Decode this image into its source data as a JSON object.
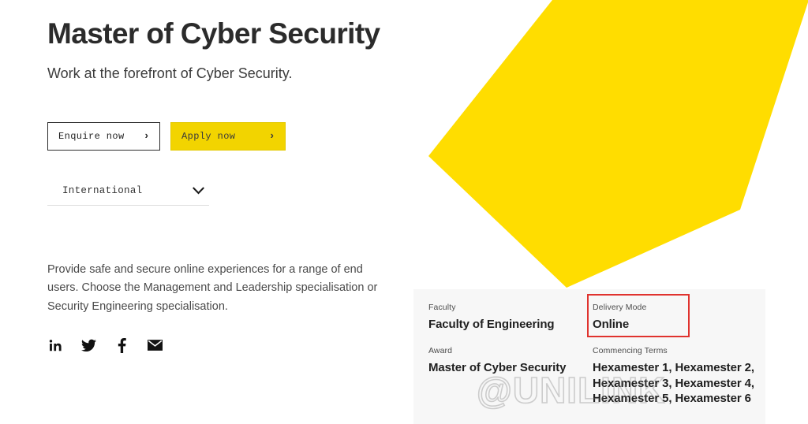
{
  "hero": {
    "title": "Master of Cyber Security",
    "subtitle": "Work at the forefront of Cyber Security.",
    "shape_color": "#FFDD00"
  },
  "actions": {
    "enquire_label": "Enquire now",
    "apply_label": "Apply now",
    "chevron": "›",
    "apply_color": "#F2D400"
  },
  "student_type_select": {
    "value": "International",
    "icon": "chevron-down-icon"
  },
  "description": "Provide safe and secure online experiences for a range of end users. Choose the Management and Leadership specialisation or Security Engineering specialisation.",
  "social": [
    {
      "name": "linkedin-icon",
      "label": "LinkedIn"
    },
    {
      "name": "twitter-icon",
      "label": "Twitter"
    },
    {
      "name": "facebook-icon",
      "label": "Facebook"
    },
    {
      "name": "email-icon",
      "label": "Email"
    }
  ],
  "info_panel": {
    "faculty_label": "Faculty",
    "faculty_value": "Faculty of Engineering",
    "delivery_label": "Delivery Mode",
    "delivery_value": "Online",
    "award_label": "Award",
    "award_value": "Master of Cyber Security",
    "terms_label": "Commencing Terms",
    "terms_value": "Hexamester 1, Hexamester 2, Hexamester 3, Hexamester 4, Hexamester 5, Hexamester 6"
  },
  "annotation": {
    "color": "#E0332E",
    "target": "Delivery Mode"
  },
  "watermark": {
    "text": "@UNILINK"
  }
}
